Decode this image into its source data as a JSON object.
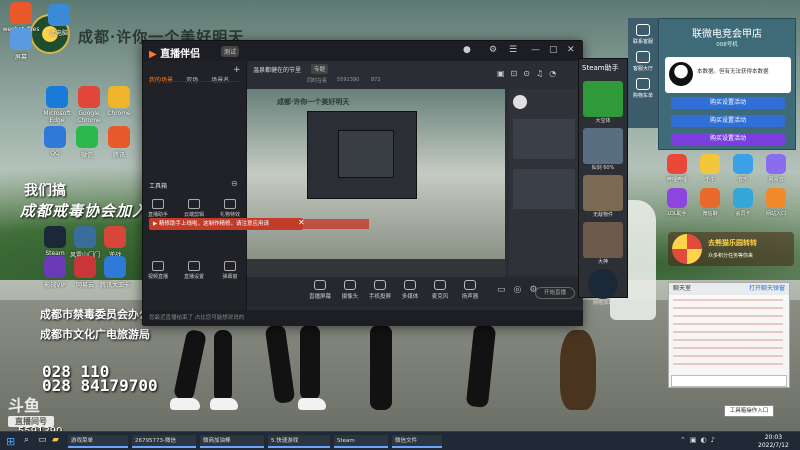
{
  "banner": {
    "title": "成都·许你一个美好明天",
    "slogan1": "我们搞",
    "slogan2": "成都戒毒协会加入大好时",
    "info1": "成都市禁毒委员会办公",
    "info2": "成都市文化广电旅游局",
    "phone1": "028  110",
    "phone2": "028 84179700"
  },
  "watermark": {
    "logo": "斗鱼",
    "sub": "直播间号",
    "room_id": "5591390"
  },
  "desktop_icons": [
    "wechat_files",
    "此电脑",
    "屏幕",
    "Microsoft Edge",
    "Google Chrome",
    "Chrome",
    "QQ",
    "微信",
    "腾讯",
    "Steam",
    "风雷山门门",
    "逆战",
    "影视VIP",
    "网易云",
    "腾讯大王卡"
  ],
  "window": {
    "logo": "直播伴侣",
    "version": "测试",
    "tabs": [
      {
        "label": "我的场景"
      },
      {
        "label": "双场"
      },
      {
        "label": "场景名"
      }
    ],
    "stream_title": "温泉都健在的节里",
    "stream_tag": "专题",
    "stats": [
      "同时在看",
      "5591390",
      "872"
    ],
    "toolbar_label": "工具箱",
    "tools": [
      {
        "label": "直播助手"
      },
      {
        "label": "云端剪辑"
      },
      {
        "label": "礼物特效"
      },
      {
        "label": "视频直播"
      },
      {
        "label": "直播设置"
      },
      {
        "label": "弹幕窗"
      }
    ],
    "notice": "▶ 精修助手上线啦，这制作精修，请注意应用请",
    "bottom_buttons": [
      {
        "label": "直播屏幕"
      },
      {
        "label": "摄像头"
      },
      {
        "label": "手机投屏"
      },
      {
        "label": "多媒体"
      },
      {
        "label": "麦克风"
      },
      {
        "label": "扬声器"
      }
    ],
    "start_button": "开始直播",
    "status": "您最近直播结束了 占比您可能想说说的"
  },
  "steam_assistant": {
    "title": "Steam助手",
    "items": [
      {
        "label": "大宝体"
      },
      {
        "label": "仙剑 60%"
      },
      {
        "label": "无敌物件"
      },
      {
        "label": "大神"
      },
      {
        "label": "网络加速"
      }
    ]
  },
  "shop": {
    "sidebar": [
      {
        "label": "联系客服"
      },
      {
        "label": "客服大厅"
      },
      {
        "label": "购物车单"
      }
    ],
    "title": "联微电竞会甲店",
    "subtitle": "008号机",
    "ad_text": "本数据。但有无法获得本数据",
    "buttons": [
      {
        "label": "购买设置活动",
        "color": "#2f6fd6"
      },
      {
        "label": "购买设置活动",
        "color": "#2f6fd6"
      },
      {
        "label": "购买设置活动",
        "color": "#7b3fe0"
      }
    ],
    "grid": [
      {
        "label": "哔哩哔哩"
      },
      {
        "label": "千牛"
      },
      {
        "label": "音乐"
      },
      {
        "label": "网易云"
      },
      {
        "label": "LOL助手"
      },
      {
        "label": "微信聊"
      },
      {
        "label": "会员卡"
      },
      {
        "label": "网站入口"
      }
    ],
    "wheel_title": "去熊猫乐园转转",
    "wheel_sub": "众多积分任务等你来"
  },
  "chat": {
    "title": "聊天室",
    "link": "打开聊天弹窗",
    "popup": "工具箱操作入口"
  },
  "taskbar": {
    "items": [
      {
        "label": "游戏菜单"
      },
      {
        "label": "26795773-微信"
      },
      {
        "label": "微商加油棒"
      },
      {
        "label": "5.快速游戏"
      },
      {
        "label": "Steam"
      },
      {
        "label": "微信文件"
      }
    ],
    "time": "20:03",
    "date": "2022/7/12"
  }
}
